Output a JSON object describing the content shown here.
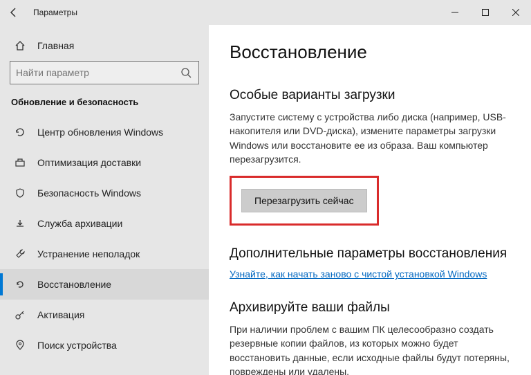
{
  "window": {
    "title": "Параметры"
  },
  "sidebar": {
    "home": "Главная",
    "search_placeholder": "Найти параметр",
    "section": "Обновление и безопасность",
    "items": [
      {
        "label": "Центр обновления Windows"
      },
      {
        "label": "Оптимизация доставки"
      },
      {
        "label": "Безопасность Windows"
      },
      {
        "label": "Служба архивации"
      },
      {
        "label": "Устранение неполадок"
      },
      {
        "label": "Восстановление"
      },
      {
        "label": "Активация"
      },
      {
        "label": "Поиск устройства"
      }
    ]
  },
  "main": {
    "heading": "Восстановление",
    "section1": {
      "title": "Особые варианты загрузки",
      "desc": "Запустите систему с устройства либо диска (например, USB-накопителя или DVD-диска), измените параметры загрузки Windows или восстановите ее из образа. Ваш компьютер перезагрузится.",
      "button": "Перезагрузить сейчас"
    },
    "section2": {
      "title": "Дополнительные параметры восстановления",
      "link": "Узнайте, как начать заново с чистой установкой Windows"
    },
    "section3": {
      "title": "Архивируйте ваши файлы",
      "desc": "При наличии проблем с вашим ПК целесообразно создать резервные копии файлов, из которых можно будет восстановить данные, если исходные файлы будут потеряны, повреждены или удалены."
    }
  }
}
